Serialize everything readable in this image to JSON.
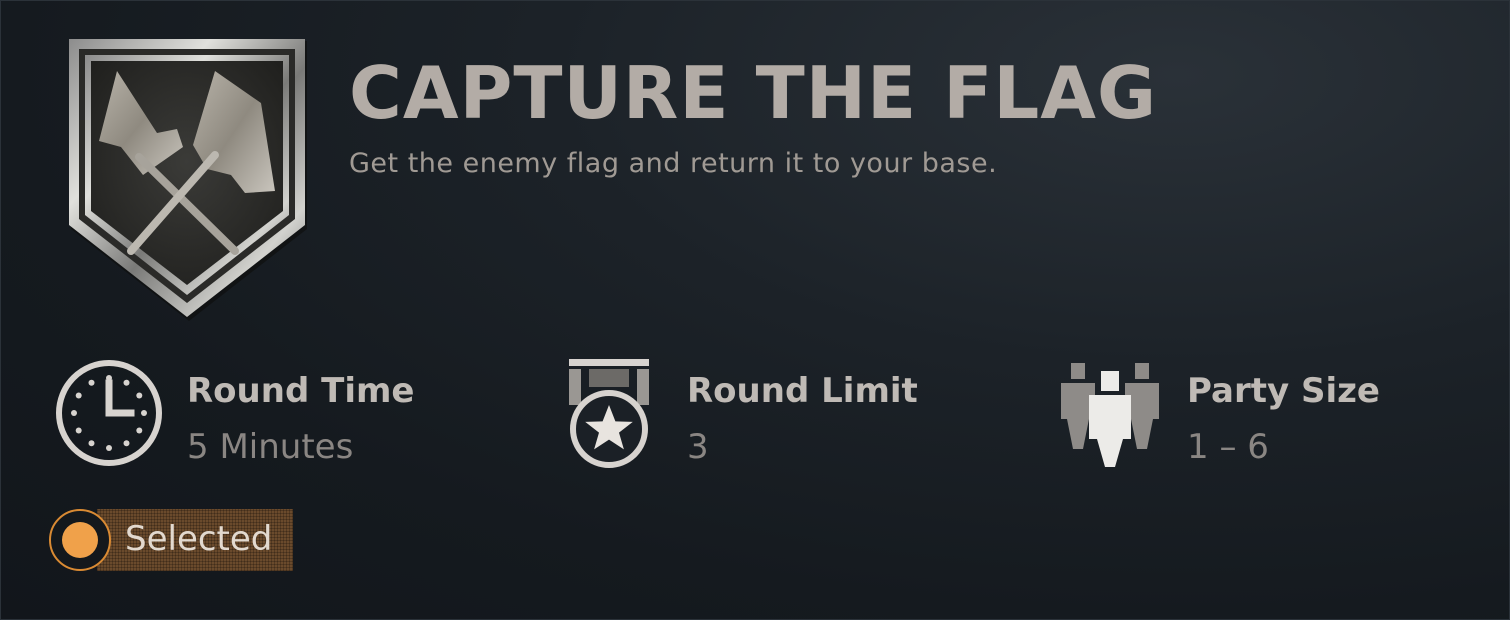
{
  "mode": {
    "title": "CAPTURE THE FLAG",
    "description": "Get the enemy flag and return it to your base.",
    "emblem_icon": "crossed-flags-shield-icon"
  },
  "stats": [
    {
      "icon": "clock-icon",
      "label": "Round Time",
      "value": "5 Minutes"
    },
    {
      "icon": "star-medal-icon",
      "label": "Round Limit",
      "value": "3"
    },
    {
      "icon": "party-icon",
      "label": "Party Size",
      "value": "1 – 6"
    }
  ],
  "status": {
    "label": "Selected",
    "selected": true
  },
  "colors": {
    "background": "#1c2228",
    "title": "#b3aca6",
    "description": "#a09a94",
    "stat_label": "#bfbab5",
    "stat_value": "#8a8683",
    "accent_orange": "#f0a14a",
    "badge_bg": "#6a4a2c"
  }
}
